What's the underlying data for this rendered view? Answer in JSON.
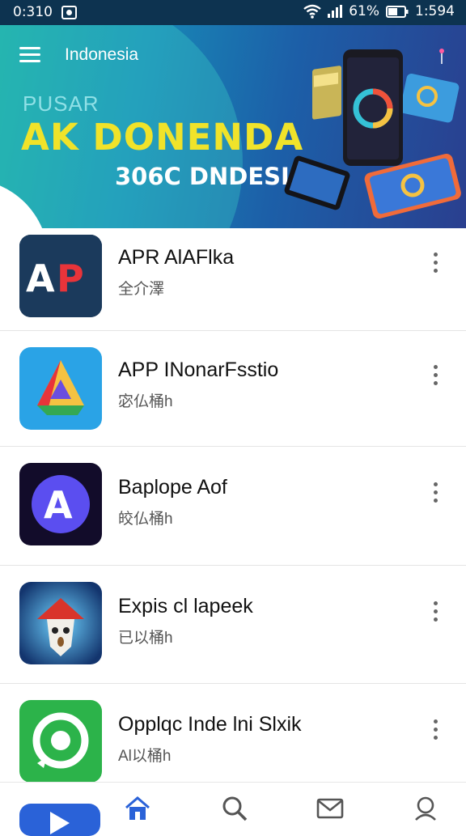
{
  "status_bar": {
    "time": "0:310",
    "battery": "61%",
    "clock": "1:594"
  },
  "header": {
    "title": "Indonesia"
  },
  "banner": {
    "line1": "PUSAR",
    "line2": "AK DONENDA",
    "line3": "306C DNDESIA"
  },
  "apps": [
    {
      "name": "APR AlAFlka",
      "subtitle": "全介澤",
      "icon": "ap-logo-icon",
      "color": "#1b3a5c"
    },
    {
      "name": "APP INonarFsstio",
      "subtitle": "宓仏桶h",
      "icon": "triangle-logo-icon",
      "color": "#2aa3e6"
    },
    {
      "name": "Baplope Aof",
      "subtitle": "皎仏桶h",
      "icon": "a-circle-logo-icon",
      "color": "#120c2a"
    },
    {
      "name": "Expis cl lapeek",
      "subtitle": "已以桶h",
      "icon": "house-mascot-icon",
      "color": "#1c4f8f"
    },
    {
      "name": "Opplqc Inde lni Slxik",
      "subtitle": "Al以桶h",
      "icon": "chat-bubble-logo-icon",
      "color": "#2cb34a"
    }
  ],
  "bottom_nav": [
    "home-icon",
    "search-icon",
    "mail-icon",
    "profile-icon"
  ],
  "colors": {
    "accent": "#2a62d8",
    "banner_yellow": "#f0e32a"
  }
}
